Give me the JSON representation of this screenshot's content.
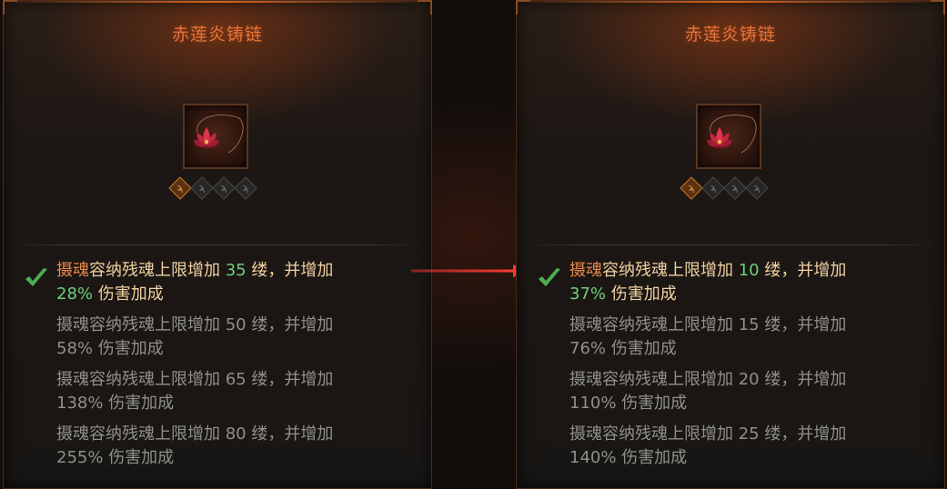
{
  "left_card": {
    "title": "赤莲炎铸链",
    "socket_glyph": "ϡ",
    "current": {
      "keyword": "摄魂",
      "line1_mid": "容纳残魂上限增加 ",
      "num1": "35",
      "line1_end": " 缕，并增加",
      "num2": "28%",
      "line2_end": " 伤害加成"
    },
    "ranks": [
      {
        "line1": "摄魂容纳残魂上限增加 50 缕，并增加",
        "line2": "58% 伤害加成"
      },
      {
        "line1": "摄魂容纳残魂上限增加 65 缕，并增加",
        "line2": "138% 伤害加成"
      },
      {
        "line1": "摄魂容纳残魂上限增加 80 缕，并增加",
        "line2": "255% 伤害加成"
      }
    ]
  },
  "right_card": {
    "title": "赤莲炎铸链",
    "socket_glyph": "ϡ",
    "current": {
      "keyword": "摄魂",
      "line1_mid": "容纳残魂上限增加 ",
      "num1": "10",
      "line1_end": " 缕，并增加",
      "num2": "37%",
      "line2_end": " 伤害加成"
    },
    "ranks": [
      {
        "line1": "摄魂容纳残魂上限增加 15 缕，并增加",
        "line2": "76% 伤害加成"
      },
      {
        "line1": "摄魂容纳残魂上限增加 20 缕，并增加",
        "line2": "110% 伤害加成"
      },
      {
        "line1": "摄魂容纳残魂上限增加 25 缕，并增加",
        "line2": "140% 伤害加成"
      }
    ]
  },
  "icons": {
    "item": "lotus-chain-icon",
    "check": "checkmark-icon",
    "arrow": "red-arrow-icon"
  },
  "colors": {
    "title": "#e3733a",
    "keyword": "#e8874a",
    "number_highlight": "#6dd07a",
    "current_text": "#f0d0a0",
    "inactive_text": "#8f8f8b",
    "check": "#4caf50",
    "arrow": "#e53935"
  }
}
